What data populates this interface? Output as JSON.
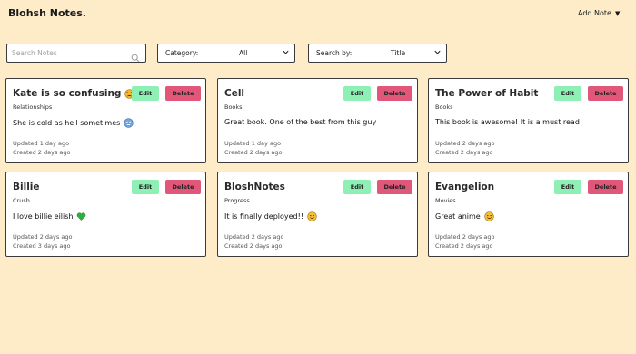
{
  "header": {
    "brand": "Blohsh Notes.",
    "add_note_label": "Add Note",
    "add_note_caret_icon": "chevron-down-icon"
  },
  "filters": {
    "search": {
      "placeholder": "Search Notes",
      "value": "",
      "icon": "search-icon"
    },
    "category": {
      "label": "Category:",
      "value": "All"
    },
    "search_by": {
      "label": "Search by:",
      "value": "Title"
    }
  },
  "notes": [
    {
      "title": "Kate is so confusing",
      "title_emoji": "angry-face-icon",
      "category": "Relationships",
      "body": "She is cold as hell sometimes",
      "body_emoji": "cold-face-icon",
      "updated": "Updated 1 day ago",
      "created": "Created 2 days ago",
      "edit_label": "Edit",
      "delete_label": "Delete"
    },
    {
      "title": "Cell",
      "title_emoji": "",
      "category": "Books",
      "body": "Great book. One of the best from this guy",
      "body_emoji": "",
      "updated": "Updated 1 day ago",
      "created": "Created 2 days ago",
      "edit_label": "Edit",
      "delete_label": "Delete"
    },
    {
      "title": "The Power of Habit",
      "title_emoji": "",
      "category": "Books",
      "body": "This book is awesome! It is a must read",
      "body_emoji": "",
      "updated": "Updated 2 days ago",
      "created": "Created 2 days ago",
      "edit_label": "Edit",
      "delete_label": "Delete"
    },
    {
      "title": "Billie",
      "title_emoji": "",
      "category": "Crush",
      "body": "I love billie eilish",
      "body_emoji": "green-heart-icon",
      "updated": "Updated 2 days ago",
      "created": "Created 3 days ago",
      "edit_label": "Edit",
      "delete_label": "Delete"
    },
    {
      "title": "BloshNotes",
      "title_emoji": "",
      "category": "Progress",
      "body": "It is finally deployed!!",
      "body_emoji": "smiling-face-icon",
      "updated": "Updated 2 days ago",
      "created": "Created 2 days ago",
      "edit_label": "Edit",
      "delete_label": "Delete"
    },
    {
      "title": "Evangelion",
      "title_emoji": "",
      "category": "Movies",
      "body": "Great anime",
      "body_emoji": "smiling-face-icon",
      "updated": "Updated 2 days ago",
      "created": "Created 2 days ago",
      "edit_label": "Edit",
      "delete_label": "Delete"
    }
  ],
  "colors": {
    "background": "#feebc8",
    "edit": "#8ef0b4",
    "delete": "#e0577a",
    "border": "#3a3a3a"
  }
}
